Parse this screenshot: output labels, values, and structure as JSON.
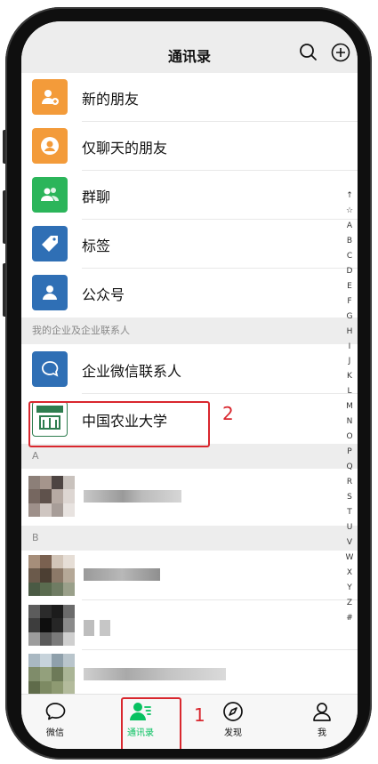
{
  "header": {
    "title": "通讯录"
  },
  "features": [
    {
      "label": "新的朋友",
      "color": "#f39b3a"
    },
    {
      "label": "仅聊天的朋友",
      "color": "#f39b3a"
    },
    {
      "label": "群聊",
      "color": "#2bb55a"
    },
    {
      "label": "标签",
      "color": "#2f6fb5"
    },
    {
      "label": "公众号",
      "color": "#2f6fb5"
    }
  ],
  "enterprise": {
    "section_title": "我的企业及企业联系人",
    "items": [
      {
        "label": "企业微信联系人",
        "color": "#2f6fb5"
      },
      {
        "label": "中国农业大学"
      }
    ]
  },
  "sections": [
    {
      "letter": "A"
    },
    {
      "letter": "B"
    }
  ],
  "index_letters": [
    "↑",
    "☆",
    "A",
    "B",
    "C",
    "D",
    "E",
    "F",
    "G",
    "H",
    "I",
    "J",
    "K",
    "L",
    "M",
    "N",
    "O",
    "P",
    "Q",
    "R",
    "S",
    "T",
    "U",
    "V",
    "W",
    "X",
    "Y",
    "Z",
    "#"
  ],
  "tabs": [
    {
      "label": "微信",
      "active": false
    },
    {
      "label": "通讯录",
      "active": true
    },
    {
      "label": "发现",
      "active": false
    },
    {
      "label": "我",
      "active": false
    }
  ],
  "annotations": [
    {
      "label": "1"
    },
    {
      "label": "2"
    }
  ],
  "colors": {
    "accent": "#07c160",
    "annotation": "#d9272e"
  }
}
